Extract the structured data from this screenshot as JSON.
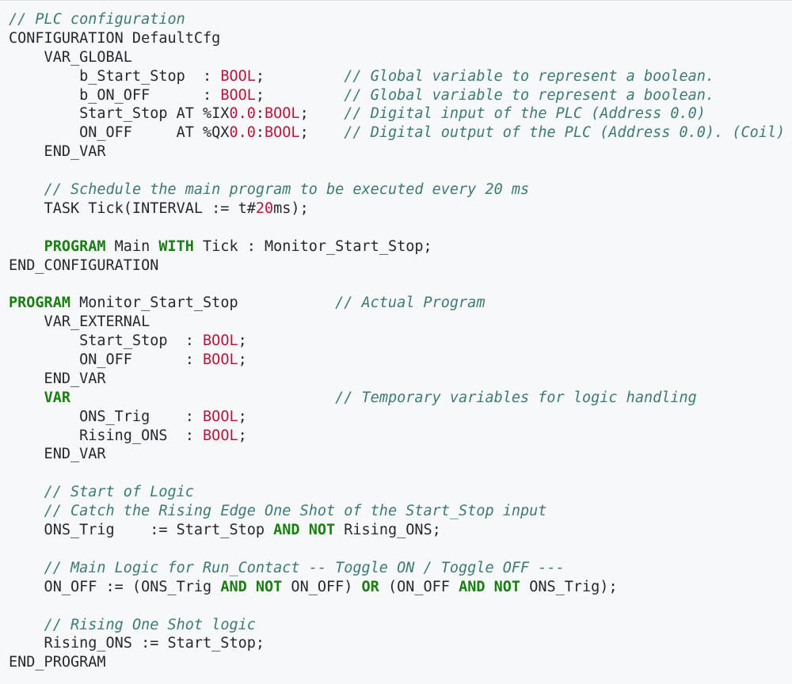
{
  "colors": {
    "background": "#f7f8f9",
    "text": "#24292f",
    "comment": "#3d7a75",
    "keyword": "#1a7f12",
    "type_literal": "#b3183a"
  },
  "code": {
    "language": "Structured Text",
    "lines": [
      [
        {
          "k": "comment",
          "t": "// PLC configuration"
        }
      ],
      [
        {
          "k": "plain",
          "t": "CONFIGURATION DefaultCfg"
        }
      ],
      [
        {
          "k": "plain",
          "t": "    VAR_GLOBAL"
        }
      ],
      [
        {
          "k": "plain",
          "t": "        b_Start_Stop  : "
        },
        {
          "k": "type",
          "t": "BOOL"
        },
        {
          "k": "plain",
          "t": ";         "
        },
        {
          "k": "comment",
          "t": "// Global variable to represent a boolean."
        }
      ],
      [
        {
          "k": "plain",
          "t": "        b_ON_OFF      : "
        },
        {
          "k": "type",
          "t": "BOOL"
        },
        {
          "k": "plain",
          "t": ";         "
        },
        {
          "k": "comment",
          "t": "// Global variable to represent a boolean."
        }
      ],
      [
        {
          "k": "plain",
          "t": "        Start_Stop AT %IX"
        },
        {
          "k": "number",
          "t": "0.0"
        },
        {
          "k": "plain",
          "t": ":"
        },
        {
          "k": "type",
          "t": "BOOL"
        },
        {
          "k": "plain",
          "t": ";    "
        },
        {
          "k": "comment",
          "t": "// Digital input of the PLC (Address 0.0)"
        }
      ],
      [
        {
          "k": "plain",
          "t": "        ON_OFF     AT %QX"
        },
        {
          "k": "number",
          "t": "0.0"
        },
        {
          "k": "plain",
          "t": ":"
        },
        {
          "k": "type",
          "t": "BOOL"
        },
        {
          "k": "plain",
          "t": ";    "
        },
        {
          "k": "comment",
          "t": "// Digital output of the PLC (Address 0.0). (Coil)"
        }
      ],
      [
        {
          "k": "plain",
          "t": "    END_VAR"
        }
      ],
      [],
      [
        {
          "k": "plain",
          "t": "    "
        },
        {
          "k": "comment",
          "t": "// Schedule the main program to be executed every 20 ms"
        }
      ],
      [
        {
          "k": "plain",
          "t": "    TASK Tick(INTERVAL := t#"
        },
        {
          "k": "number",
          "t": "20"
        },
        {
          "k": "plain",
          "t": "ms);"
        }
      ],
      [],
      [
        {
          "k": "plain",
          "t": "    "
        },
        {
          "k": "keyword",
          "t": "PROGRAM"
        },
        {
          "k": "plain",
          "t": " Main "
        },
        {
          "k": "keyword",
          "t": "WITH"
        },
        {
          "k": "plain",
          "t": " Tick : Monitor_Start_Stop;"
        }
      ],
      [
        {
          "k": "plain",
          "t": "END_CONFIGURATION"
        }
      ],
      [],
      [
        {
          "k": "keyword",
          "t": "PROGRAM"
        },
        {
          "k": "plain",
          "t": " Monitor_Start_Stop           "
        },
        {
          "k": "comment",
          "t": "// Actual Program"
        }
      ],
      [
        {
          "k": "plain",
          "t": "    VAR_EXTERNAL"
        }
      ],
      [
        {
          "k": "plain",
          "t": "        Start_Stop  : "
        },
        {
          "k": "type",
          "t": "BOOL"
        },
        {
          "k": "plain",
          "t": ";"
        }
      ],
      [
        {
          "k": "plain",
          "t": "        ON_OFF      : "
        },
        {
          "k": "type",
          "t": "BOOL"
        },
        {
          "k": "plain",
          "t": ";"
        }
      ],
      [
        {
          "k": "plain",
          "t": "    END_VAR"
        }
      ],
      [
        {
          "k": "plain",
          "t": "    "
        },
        {
          "k": "keyword",
          "t": "VAR"
        },
        {
          "k": "plain",
          "t": "                              "
        },
        {
          "k": "comment",
          "t": "// Temporary variables for logic handling"
        }
      ],
      [
        {
          "k": "plain",
          "t": "        ONS_Trig    : "
        },
        {
          "k": "type",
          "t": "BOOL"
        },
        {
          "k": "plain",
          "t": ";"
        }
      ],
      [
        {
          "k": "plain",
          "t": "        Rising_ONS  : "
        },
        {
          "k": "type",
          "t": "BOOL"
        },
        {
          "k": "plain",
          "t": ";"
        }
      ],
      [
        {
          "k": "plain",
          "t": "    END_VAR"
        }
      ],
      [],
      [
        {
          "k": "plain",
          "t": "    "
        },
        {
          "k": "comment",
          "t": "// Start of Logic"
        }
      ],
      [
        {
          "k": "plain",
          "t": "    "
        },
        {
          "k": "comment",
          "t": "// Catch the Rising Edge One Shot of the Start_Stop input"
        }
      ],
      [
        {
          "k": "plain",
          "t": "    ONS_Trig    := Start_Stop "
        },
        {
          "k": "keyword",
          "t": "AND"
        },
        {
          "k": "plain",
          "t": " "
        },
        {
          "k": "keyword",
          "t": "NOT"
        },
        {
          "k": "plain",
          "t": " Rising_ONS;"
        }
      ],
      [],
      [
        {
          "k": "plain",
          "t": "    "
        },
        {
          "k": "comment",
          "t": "// Main Logic for Run_Contact -- Toggle ON / Toggle OFF ---"
        }
      ],
      [
        {
          "k": "plain",
          "t": "    ON_OFF := (ONS_Trig "
        },
        {
          "k": "keyword",
          "t": "AND"
        },
        {
          "k": "plain",
          "t": " "
        },
        {
          "k": "keyword",
          "t": "NOT"
        },
        {
          "k": "plain",
          "t": " ON_OFF) "
        },
        {
          "k": "keyword",
          "t": "OR"
        },
        {
          "k": "plain",
          "t": " (ON_OFF "
        },
        {
          "k": "keyword",
          "t": "AND"
        },
        {
          "k": "plain",
          "t": " "
        },
        {
          "k": "keyword",
          "t": "NOT"
        },
        {
          "k": "plain",
          "t": " ONS_Trig);"
        }
      ],
      [],
      [
        {
          "k": "plain",
          "t": "    "
        },
        {
          "k": "comment",
          "t": "// Rising One Shot logic"
        }
      ],
      [
        {
          "k": "plain",
          "t": "    Rising_ONS := Start_Stop;"
        }
      ],
      [
        {
          "k": "plain",
          "t": "END_PROGRAM"
        }
      ]
    ]
  }
}
